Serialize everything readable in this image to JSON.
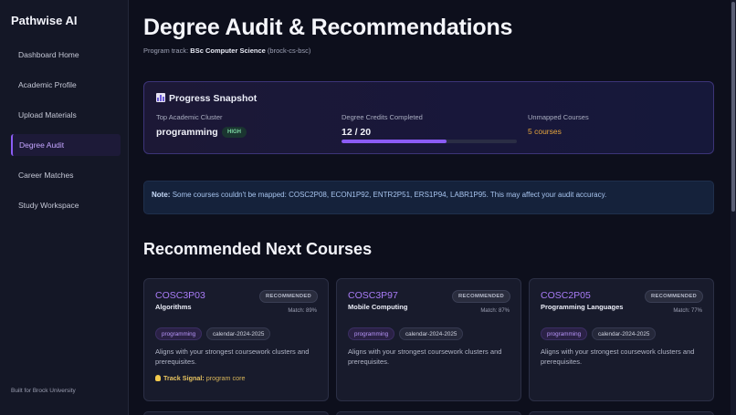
{
  "app": {
    "brand": "Pathwise AI",
    "footer": "Built for Brock University"
  },
  "sidebar": {
    "items": [
      {
        "label": "Dashboard Home"
      },
      {
        "label": "Academic Profile"
      },
      {
        "label": "Upload Materials"
      },
      {
        "label": "Degree Audit",
        "active": true
      },
      {
        "label": "Career Matches"
      },
      {
        "label": "Study Workspace"
      }
    ]
  },
  "header": {
    "title": "Degree Audit & Recommendations",
    "track_prefix": "Program track:",
    "program": "BSc Computer Science",
    "program_id": "(brock-cs-bsc)"
  },
  "snapshot": {
    "title": "Progress Snapshot",
    "icon": "bar-chart-icon",
    "cluster_label": "Top Academic Cluster",
    "cluster_value": "programming",
    "cluster_badge": "HIGH",
    "credits_label": "Degree Credits Completed",
    "credits_value": "12 / 20",
    "credits_progress": 0.6,
    "unmapped_label": "Unmapped Courses",
    "unmapped_value": "5 courses"
  },
  "note": {
    "label": "Note:",
    "text": "Some courses couldn't be mapped: COSC2P08, ECON1P92, ENTR2P51, ERS1P94, LABR1P95. This may affect your audit accuracy."
  },
  "recommendations": {
    "title": "Recommended Next Courses",
    "cards": [
      {
        "code": "COSC3P03",
        "name": "Algorithms",
        "badge": "RECOMMENDED",
        "match": "Match: 89%",
        "tags": [
          "programming",
          "calendar-2024-2025"
        ],
        "desc": "Aligns with your strongest coursework clusters and prerequisites.",
        "signal_label": "Track Signal:",
        "signal_value": "program core"
      },
      {
        "code": "COSC3P97",
        "name": "Mobile Computing",
        "badge": "RECOMMENDED",
        "match": "Match: 87%",
        "tags": [
          "programming",
          "calendar-2024-2025"
        ],
        "desc": "Aligns with your strongest coursework clusters and prerequisites."
      },
      {
        "code": "COSC2P05",
        "name": "Programming Languages",
        "badge": "RECOMMENDED",
        "match": "Match: 77%",
        "tags": [
          "programming",
          "calendar-2024-2025"
        ],
        "desc": "Aligns with your strongest coursework clusters and prerequisites."
      }
    ]
  },
  "colors": {
    "accent": "#8b5cf6",
    "warning": "#e6a53d",
    "success": "#7ad3a0",
    "info": "#a7c4ee"
  }
}
